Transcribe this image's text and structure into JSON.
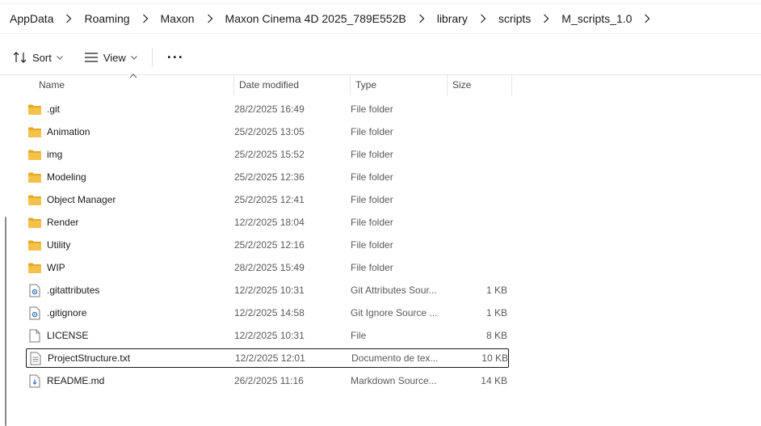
{
  "breadcrumb": [
    "AppData",
    "Roaming",
    "Maxon",
    "Maxon Cinema 4D 2025_789E552B",
    "library",
    "scripts",
    "M_scripts_1.0"
  ],
  "toolbar": {
    "sort_label": "Sort",
    "view_label": "View",
    "more_label": "···"
  },
  "columns": {
    "name": "Name",
    "date": "Date modified",
    "type": "Type",
    "size": "Size"
  },
  "files": [
    {
      "name": ".git",
      "date": "28/2/2025 16:49",
      "type": "File folder",
      "size": "",
      "icon": "folder-icon"
    },
    {
      "name": "Animation",
      "date": "25/2/2025 13:05",
      "type": "File folder",
      "size": "",
      "icon": "folder-icon"
    },
    {
      "name": "img",
      "date": "25/2/2025 15:52",
      "type": "File folder",
      "size": "",
      "icon": "folder-icon"
    },
    {
      "name": "Modeling",
      "date": "25/2/2025 12:36",
      "type": "File folder",
      "size": "",
      "icon": "folder-icon"
    },
    {
      "name": "Object Manager",
      "date": "25/2/2025 12:41",
      "type": "File folder",
      "size": "",
      "icon": "folder-icon"
    },
    {
      "name": "Render",
      "date": "12/2/2025 18:04",
      "type": "File folder",
      "size": "",
      "icon": "folder-icon"
    },
    {
      "name": "Utility",
      "date": "25/2/2025 12:16",
      "type": "File folder",
      "size": "",
      "icon": "folder-icon"
    },
    {
      "name": "WIP",
      "date": "28/2/2025 15:49",
      "type": "File folder",
      "size": "",
      "icon": "folder-icon"
    },
    {
      "name": ".gitattributes",
      "date": "12/2/2025 10:31",
      "type": "Git Attributes Sour...",
      "size": "1 KB",
      "icon": "settings-file-icon"
    },
    {
      "name": ".gitignore",
      "date": "12/2/2025 14:58",
      "type": "Git Ignore Source ...",
      "size": "1 KB",
      "icon": "settings-file-icon"
    },
    {
      "name": "LICENSE",
      "date": "12/2/2025 10:31",
      "type": "File",
      "size": "8 KB",
      "icon": "file-icon"
    },
    {
      "name": "ProjectStructure.txt",
      "date": "12/2/2025 12:01",
      "type": "Documento de tex...",
      "size": "10 KB",
      "icon": "text-file-icon",
      "selected": true
    },
    {
      "name": "README.md",
      "date": "26/2/2025 11:16",
      "type": "Markdown Source...",
      "size": "14 KB",
      "icon": "markdown-file-icon"
    }
  ],
  "colors": {
    "folder": "#f4c24a",
    "folder_dark": "#e5a92a",
    "selection_border": "#1a1a1a"
  }
}
